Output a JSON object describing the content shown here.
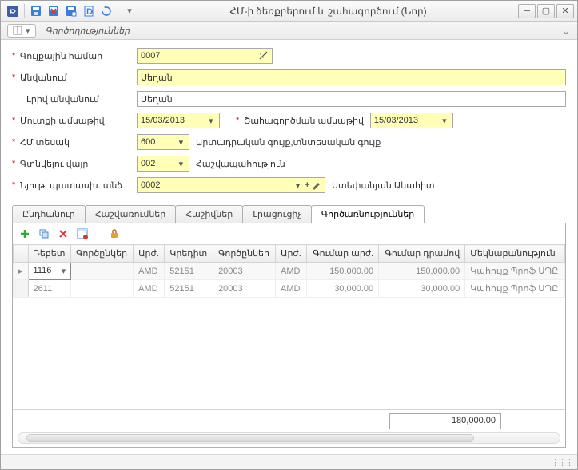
{
  "window": {
    "title": "ՀՄ-ի ձեռքբերում և շահագործում (Նոր)"
  },
  "subbar": {
    "section": "Գործողություններ"
  },
  "form": {
    "inventory_label": "Գույքային համար",
    "inventory_value": "0007",
    "name_label": "Անվանում",
    "name_value": "Սեղան",
    "fullname_label": "Լրիվ անվանում",
    "fullname_value": "Սեղան",
    "entry_date_label": "Մուտքի ամսաթիվ",
    "entry_date_value": "15/03/2013",
    "exploit_date_label": "Շահագործման ամսաթիվ",
    "exploit_date_value": "15/03/2013",
    "type_label": "ՀՄ տեսակ",
    "type_value": "600",
    "type_desc": "Արտադրական գույք,տնտեսական գույք",
    "location_label": "Գտնվելու վայր",
    "location_value": "002",
    "location_desc": "Հաշվապահություն",
    "responsible_label": "Նյութ. պատասխ. անձ",
    "responsible_value": "0002",
    "responsible_desc": "Ստեփանյան Անահիտ"
  },
  "tabs": [
    {
      "label": "Ընդհանուր"
    },
    {
      "label": "Հաշվառումներ"
    },
    {
      "label": "Հաշիվներ"
    },
    {
      "label": "Լրացուցիչ"
    },
    {
      "label": "Գործառնություններ"
    }
  ],
  "grid": {
    "headers": {
      "debit": "Դեբետ",
      "partners1": "Գործընկեր",
      "cur1": "Արժ.",
      "credit": "Կրեդիտ",
      "partners2": "Գործընկեր",
      "cur2": "Արժ.",
      "amount_cur": "Գումար արժ.",
      "amount_dram": "Գումար դրամով",
      "comment": "Մեկնաբանություն"
    },
    "rows": [
      {
        "debit": "1116",
        "partners1": "",
        "cur1": "AMD",
        "credit": "52151",
        "partners2": "20003",
        "cur2": "AMD",
        "amount_cur": "150,000.00",
        "amount_dram": "150,000.00",
        "comment": "Կահույք Պրոֆ ՍՊԸ"
      },
      {
        "debit": "2611",
        "partners1": "",
        "cur1": "AMD",
        "credit": "52151",
        "partners2": "20003",
        "cur2": "AMD",
        "amount_cur": "30,000.00",
        "amount_dram": "30,000.00",
        "comment": "Կահույք Պրոֆ ՍՊԸ"
      }
    ],
    "total": "180,000.00"
  }
}
